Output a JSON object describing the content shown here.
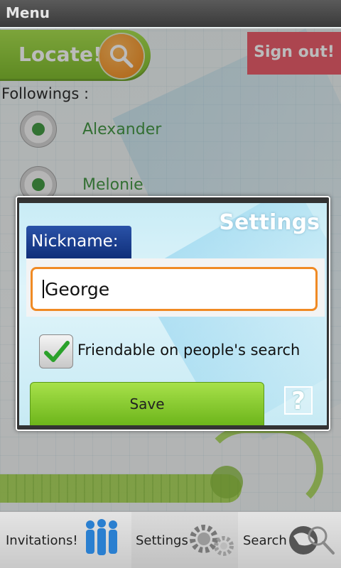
{
  "window": {
    "title": "Menu"
  },
  "top": {
    "locate_label": "Locate!",
    "signout_label": "Sign out!",
    "followings_label": "Followings :",
    "followings": [
      {
        "name": "Alexander"
      },
      {
        "name": "Melonie"
      }
    ]
  },
  "dialog": {
    "title": "Settings",
    "nickname_label": "Nickname:",
    "nickname_value": "George",
    "friendable_label": "Friendable on people's search",
    "friendable_checked": true,
    "save_label": "Save",
    "help_label": "?"
  },
  "tabs": [
    {
      "label": "Invitations!",
      "icon": "people-icon"
    },
    {
      "label": "Settings",
      "icon": "gears-icon"
    },
    {
      "label": "Search",
      "icon": "globe-search-icon"
    }
  ],
  "colors": {
    "accent_green": "#7fc424",
    "signout_red": "#e84a5a",
    "nickname_blue": "#1a3f8f",
    "input_border": "#f08a24"
  }
}
